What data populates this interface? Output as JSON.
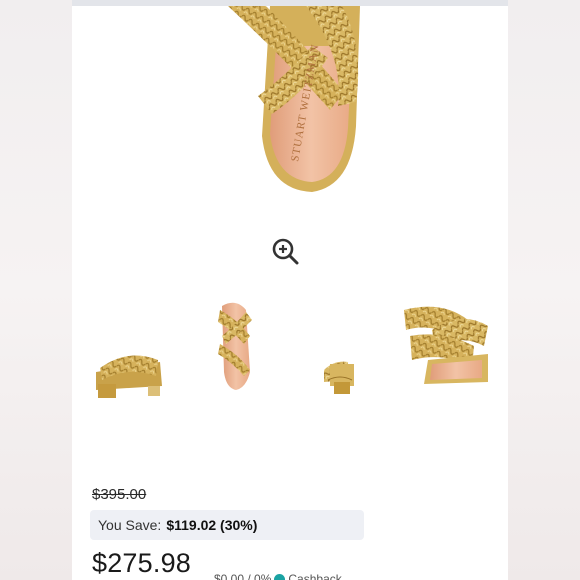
{
  "product": {
    "brand_text": "STUART WEITZMAN",
    "original_price": "$395.00",
    "savings_label": "You Save:",
    "savings_value": "$119.02 (30%)",
    "current_price": "$275.98",
    "extra_partial": "$0.00 / 0%",
    "cashback_partial": "Cashback"
  },
  "icons": {
    "zoom": "zoom-in-icon"
  },
  "colors": {
    "gold": "#c9a24a",
    "gold_dark": "#8a6a22",
    "insole": "#eab294",
    "savings_bg": "#eef0f5",
    "teal": "#1aa3a3"
  }
}
